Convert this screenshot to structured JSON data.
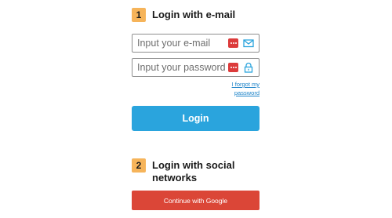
{
  "email_section": {
    "step": "1",
    "title": "Login with e-mail"
  },
  "form": {
    "email_placeholder": "Input your e-mail",
    "password_placeholder": "Input your password",
    "forgot_line1": "I forgot my",
    "forgot_line2": "password",
    "login_label": "Login"
  },
  "social_section": {
    "step": "2",
    "title_line1": "Login with social",
    "title_line2": "networks",
    "google_label": "Continue with Google"
  },
  "icons": {
    "password_manager": "password-manager-icon",
    "email": "envelope-icon",
    "password": "padlock-icon"
  },
  "colors": {
    "step_badge": "#f6b45a",
    "login_button": "#2aa4dd",
    "google_button": "#db4637",
    "password_manager_icon": "#dc3b3b",
    "link": "#1a82c8",
    "field_icon": "#2aa4dd"
  }
}
